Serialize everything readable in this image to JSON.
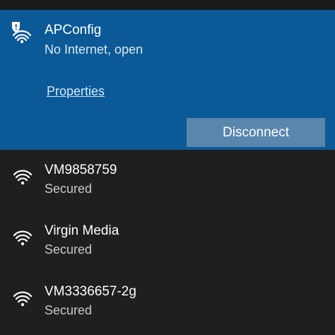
{
  "active_network": {
    "name": "APConfig",
    "status": "No Internet, open",
    "properties_label": "Properties",
    "disconnect_label": "Disconnect",
    "icon": "wifi-warning-icon"
  },
  "networks": [
    {
      "name": "VM9858759",
      "status": "Secured",
      "icon": "wifi-signal-icon"
    },
    {
      "name": "Virgin Media",
      "status": "Secured",
      "icon": "wifi-signal-icon"
    },
    {
      "name": "VM3336657-2g",
      "status": "Secured",
      "icon": "wifi-signal-icon"
    }
  ],
  "colors": {
    "background": "#1f1f1f",
    "selected_background": "#0b5a97",
    "button_background": "#5a86ad",
    "link": "#d4e7fb",
    "secondary_text": "#c8c8c8"
  }
}
